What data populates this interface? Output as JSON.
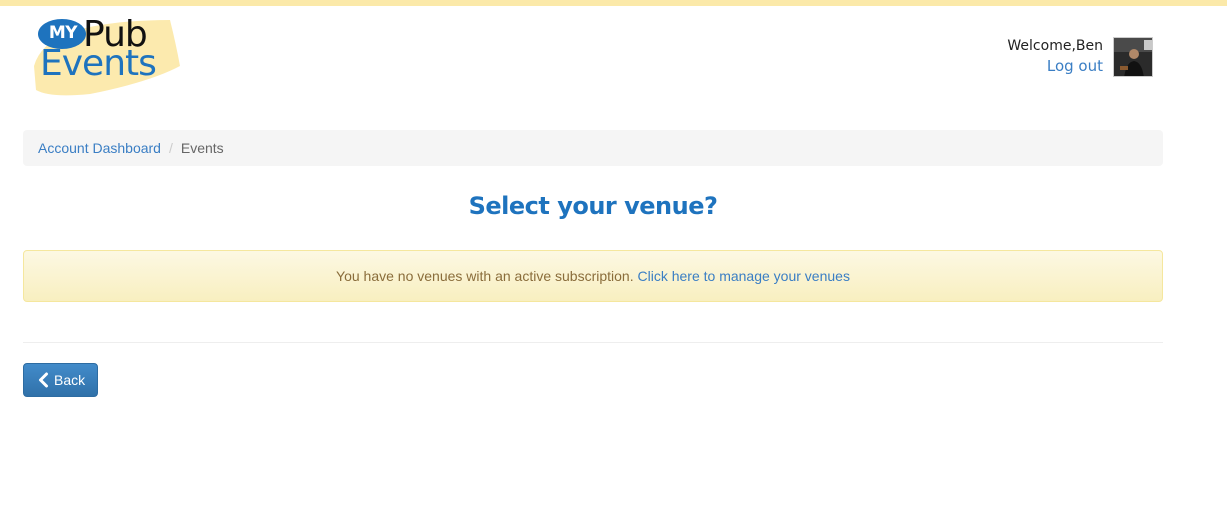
{
  "logo": {
    "my": "MY",
    "pub": "Pub",
    "events": "Events"
  },
  "user": {
    "welcome": "Welcome,Ben",
    "logout": "Log out"
  },
  "breadcrumb": {
    "items": [
      {
        "label": "Account Dashboard"
      },
      {
        "label": "Events"
      }
    ],
    "separator": "/"
  },
  "page": {
    "title": "Select your venue?"
  },
  "alert": {
    "message": "You have no venues with an active subscription.",
    "link": "Click here to manage your venues"
  },
  "back_button": {
    "label": "Back",
    "icon": "chevron-left-icon"
  },
  "colors": {
    "brand_blue": "#1e73be",
    "link_blue": "#3a7ec4",
    "alert_bg": "#fcf8e3",
    "button_blue": "#428bca",
    "top_strip": "#fbe9a9"
  }
}
